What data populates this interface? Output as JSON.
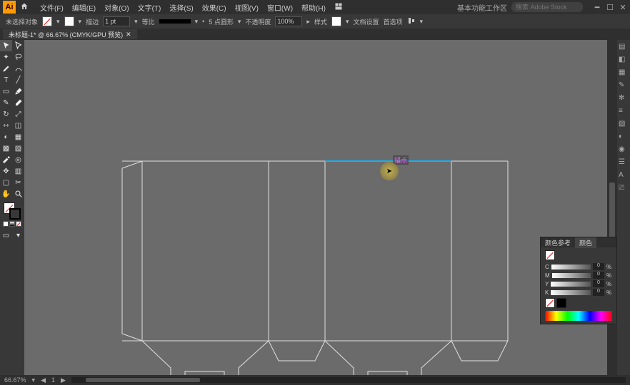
{
  "app": {
    "initials": "Ai"
  },
  "menu": {
    "file": "文件(F)",
    "edit": "编辑(E)",
    "object": "对象(O)",
    "type": "文字(T)",
    "select": "选择(S)",
    "effect": "效果(C)",
    "view": "视图(V)",
    "window": "窗口(W)",
    "help": "帮助(H)"
  },
  "workspace": {
    "label": "基本功能工作区"
  },
  "search": {
    "placeholder": "搜索 Adobe Stock"
  },
  "control": {
    "no_selection": "未选择对象",
    "stroke_label": "描边",
    "stroke_weight": "1 pt",
    "uniform": "等比",
    "point_size_label": "5 点圆形",
    "opacity_label": "不透明度",
    "opacity": "100%",
    "style_label": "样式",
    "doc_setup": "文档设置",
    "preferences": "首选项"
  },
  "tab": {
    "title": "未标题-1* @ 66.67% (CMYK/GPU 预览)"
  },
  "smartguide": {
    "label": "锚点"
  },
  "status": {
    "zoom": "66.67%",
    "artboard_nav": "1"
  },
  "color_panel": {
    "tab1": "颜色参考",
    "tab2": "颜色",
    "channels": [
      {
        "label": "C",
        "value": "0"
      },
      {
        "label": "M",
        "value": "0"
      },
      {
        "label": "Y",
        "value": "0"
      },
      {
        "label": "K",
        "value": "0"
      }
    ]
  },
  "tools": {
    "left": [
      [
        "selection",
        "direct-selection"
      ],
      [
        "magic-wand",
        "lasso"
      ],
      [
        "pen",
        "curvature"
      ],
      [
        "type",
        "line-segment"
      ],
      [
        "rectangle",
        "paintbrush"
      ],
      [
        "shaper",
        "eraser"
      ],
      [
        "rotate",
        "scale"
      ],
      [
        "width",
        "free-transform"
      ],
      [
        "shape-builder",
        "perspective"
      ],
      [
        "mesh",
        "gradient"
      ],
      [
        "eyedropper",
        "blend"
      ],
      [
        "symbol-sprayer",
        "column-graph"
      ],
      [
        "artboard",
        "slice"
      ],
      [
        "hand",
        "zoom"
      ]
    ]
  },
  "colors": {
    "canvas": "#6b6b6b",
    "panel": "#383838",
    "accent": "#ff9a00"
  }
}
